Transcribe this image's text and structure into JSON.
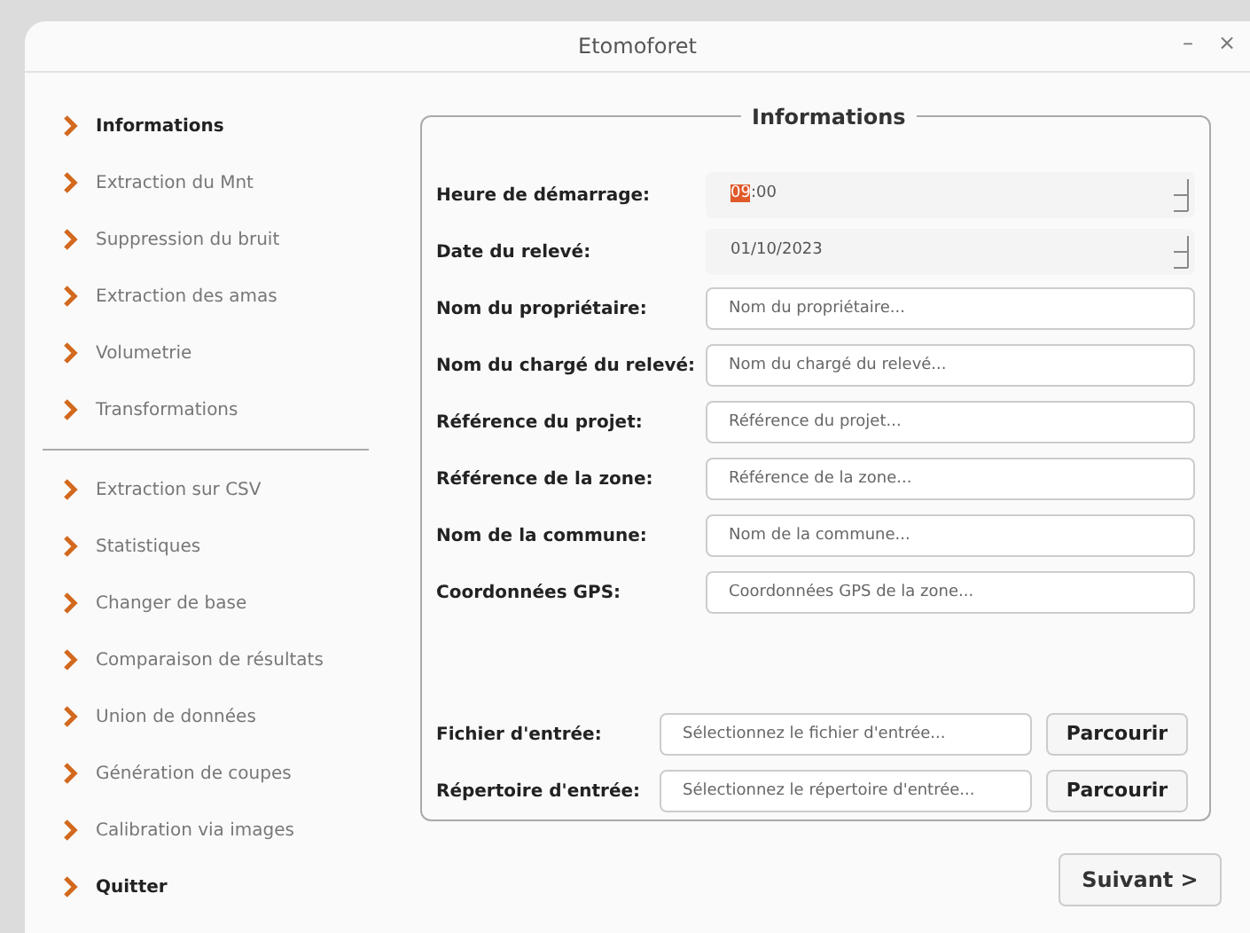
{
  "window": {
    "title": "Etomoforet",
    "controls": [
      "–",
      "×"
    ]
  },
  "sidebar": {
    "main_items": [
      {
        "label": "Informations",
        "selected": true
      },
      {
        "label": "Extraction du Mnt",
        "selected": false
      },
      {
        "label": "Suppression du bruit",
        "selected": false
      },
      {
        "label": "Extraction des amas",
        "selected": false
      },
      {
        "label": "Volumetrie",
        "selected": false
      },
      {
        "label": "Transformations",
        "selected": false
      }
    ],
    "tool_items": [
      {
        "label": "Extraction sur CSV",
        "selected": false
      },
      {
        "label": "Statistiques",
        "selected": false
      },
      {
        "label": "Changer de base",
        "selected": false
      },
      {
        "label": "Comparaison de résultats",
        "selected": false
      },
      {
        "label": "Union de données",
        "selected": false
      },
      {
        "label": "Génération de coupes",
        "selected": false
      },
      {
        "label": "Calibration via images",
        "selected": false
      }
    ],
    "quit": {
      "label": "Quitter"
    }
  },
  "group": {
    "title": "Informations",
    "fields": [
      {
        "kind": "time",
        "label": "Heure de démarrage:",
        "selected_text": "09",
        "value": ":00"
      },
      {
        "kind": "date",
        "label": "Date du relevé:",
        "value": "01/10/2023"
      },
      {
        "kind": "text",
        "label": "Nom du propriétaire:",
        "placeholder": "Nom du propriétaire..."
      },
      {
        "kind": "text",
        "label": "Nom du chargé du relevé:",
        "placeholder": "Nom du chargé du relevé..."
      },
      {
        "kind": "text",
        "label": "Référence du projet:",
        "placeholder": "Référence du projet..."
      },
      {
        "kind": "text",
        "label": "Référence de la zone:",
        "placeholder": "Référence de la zone..."
      },
      {
        "kind": "text",
        "label": "Nom de la commune:",
        "placeholder": "Nom de la commune..."
      },
      {
        "kind": "text",
        "label": "Coordonnées GPS:",
        "placeholder": "Coordonnées GPS de la zone..."
      }
    ],
    "file_fields": [
      {
        "label": "Fichier d'entrée:",
        "placeholder": "Sélectionnez le fichier d'entrée...",
        "button": "Parcourir"
      },
      {
        "label": "Répertoire d'entrée:",
        "placeholder": "Sélectionnez le répertoire d'entrée...",
        "button": "Parcourir"
      }
    ]
  },
  "next_button": "Suivant >"
}
